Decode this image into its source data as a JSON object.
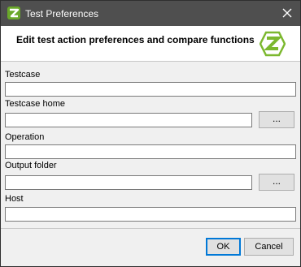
{
  "window": {
    "title": "Test Preferences",
    "icon": "app-logo-icon",
    "close_icon": "close-icon"
  },
  "header": {
    "title": "Edit test action preferences and compare functions",
    "logo": "app-logo-icon"
  },
  "form": {
    "testcase": {
      "label": "Testcase",
      "value": ""
    },
    "testcase_home": {
      "label": "Testcase home",
      "value": "",
      "browse_label": "..."
    },
    "operation": {
      "label": "Operation",
      "value": ""
    },
    "output_folder": {
      "label": "Output folder",
      "value": "",
      "browse_label": "..."
    },
    "host": {
      "label": "Host",
      "value": ""
    }
  },
  "buttons": {
    "ok": "OK",
    "cancel": "Cancel"
  },
  "colors": {
    "titlebar": "#4f4f4f",
    "logo_green": "#7cb82f",
    "ok_border": "#0078d7"
  }
}
